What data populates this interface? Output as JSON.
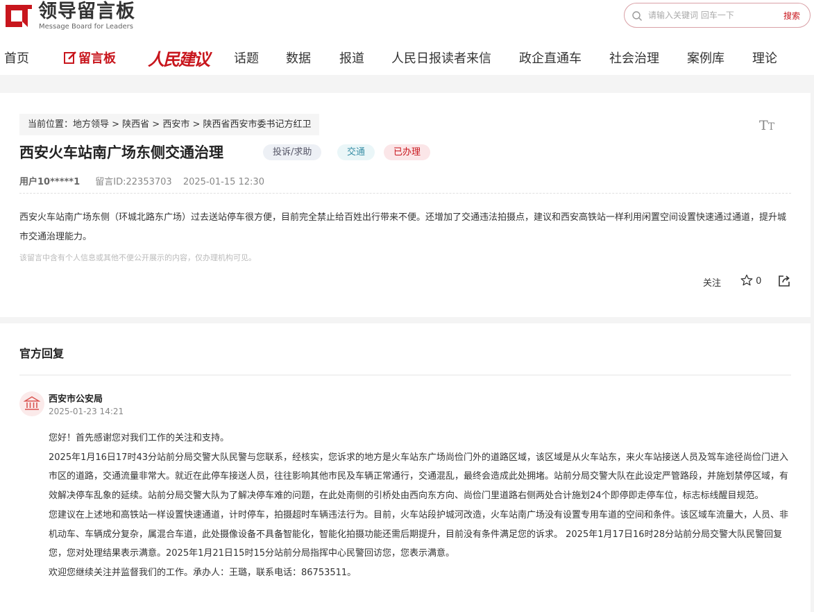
{
  "header": {
    "logo_cn": "领导留言板",
    "logo_en": "Message Board for Leaders",
    "search_placeholder": "请输入关键词 回车一下",
    "search_button": "搜索"
  },
  "nav": {
    "items": [
      {
        "label": "首页"
      },
      {
        "label": "留言板"
      },
      {
        "label": "人民建议"
      },
      {
        "label": "话题"
      },
      {
        "label": "数据"
      },
      {
        "label": "报道"
      },
      {
        "label": "人民日报读者来信"
      },
      {
        "label": "政企直通车"
      },
      {
        "label": "社会治理"
      },
      {
        "label": "案例库"
      },
      {
        "label": "理论"
      }
    ]
  },
  "message": {
    "breadcrumb": "当前位置：地方领导 > 陕西省 > 西安市 > 陕西省西安市委书记方红卫",
    "font_toggle": "TT",
    "title": "西安火车站南广场东侧交通治理",
    "tags": {
      "category": "投诉/求助",
      "field": "交通",
      "status": "已办理"
    },
    "user": "用户10*****1",
    "message_id": "留言ID:22353703",
    "datetime": "2025-01-15 12:30",
    "content": "西安火车站南广场东侧（环城北路东广场）过去送站停车很方便，目前完全禁止给百姓出行带来不便。还增加了交通违法拍摄点，建议和西安高铁站一样利用闲置空间设置快速通过通道，提升城市交通治理能力。",
    "notice": "该留言中含有个人信息或其他不便公开展示的内容，仅办理机构可见。",
    "follow_label": "关注",
    "star_count": "0"
  },
  "reply": {
    "heading": "官方回复",
    "org": "西安市公安局",
    "date": "2025-01-23 14:21",
    "paragraphs": [
      "您好！首先感谢您对我们工作的关注和支持。",
      "2025年1月16日17时43分站前分局交警大队民警与您联系，经核实，您诉求的地方是火车站东广场尚俭门外的道路区域，该区域是从火车站东，来火车站接送人员及驾车途径尚俭门进入市区的道路，交通流量非常大。就近在此停车接送人员，往往影响其他市民及车辆正常通行，交通混乱，最终会造成此处拥堵。站前分局交警大队在此设定严管路段，并施划禁停区域，有效解决停车乱象的延续。站前分局交警大队为了解决停车难的问题，在此处南侧的引桥处由西向东方向、尚俭门里道路右侧两处合计施划24个即停即走停车位，标志标线醒目规范。",
      "您建议在上述地和高铁站一样设置快速通道，计时停车，拍摄超时车辆违法行为。目前，火车站段护城河改造，火车站南广场没有设置专用车道的空间和条件。该区域车流量大，人员、非机动车、车辆成分复杂，属混合车道，此处摄像设备不具备智能化，智能化拍摄功能还需后期提升，目前没有条件满足您的诉求。 2025年1月17日16时28分站前分局交警大队民警回复您，您对处理结果表示满意。2025年1月21日15时15分站前分局指挥中心民警回访您，您表示满意。",
      "欢迎您继续关注并监督我们的工作。承办人：王璐，联系电话：86753511。"
    ]
  },
  "colors": {
    "brand_red": "#c8161d"
  }
}
